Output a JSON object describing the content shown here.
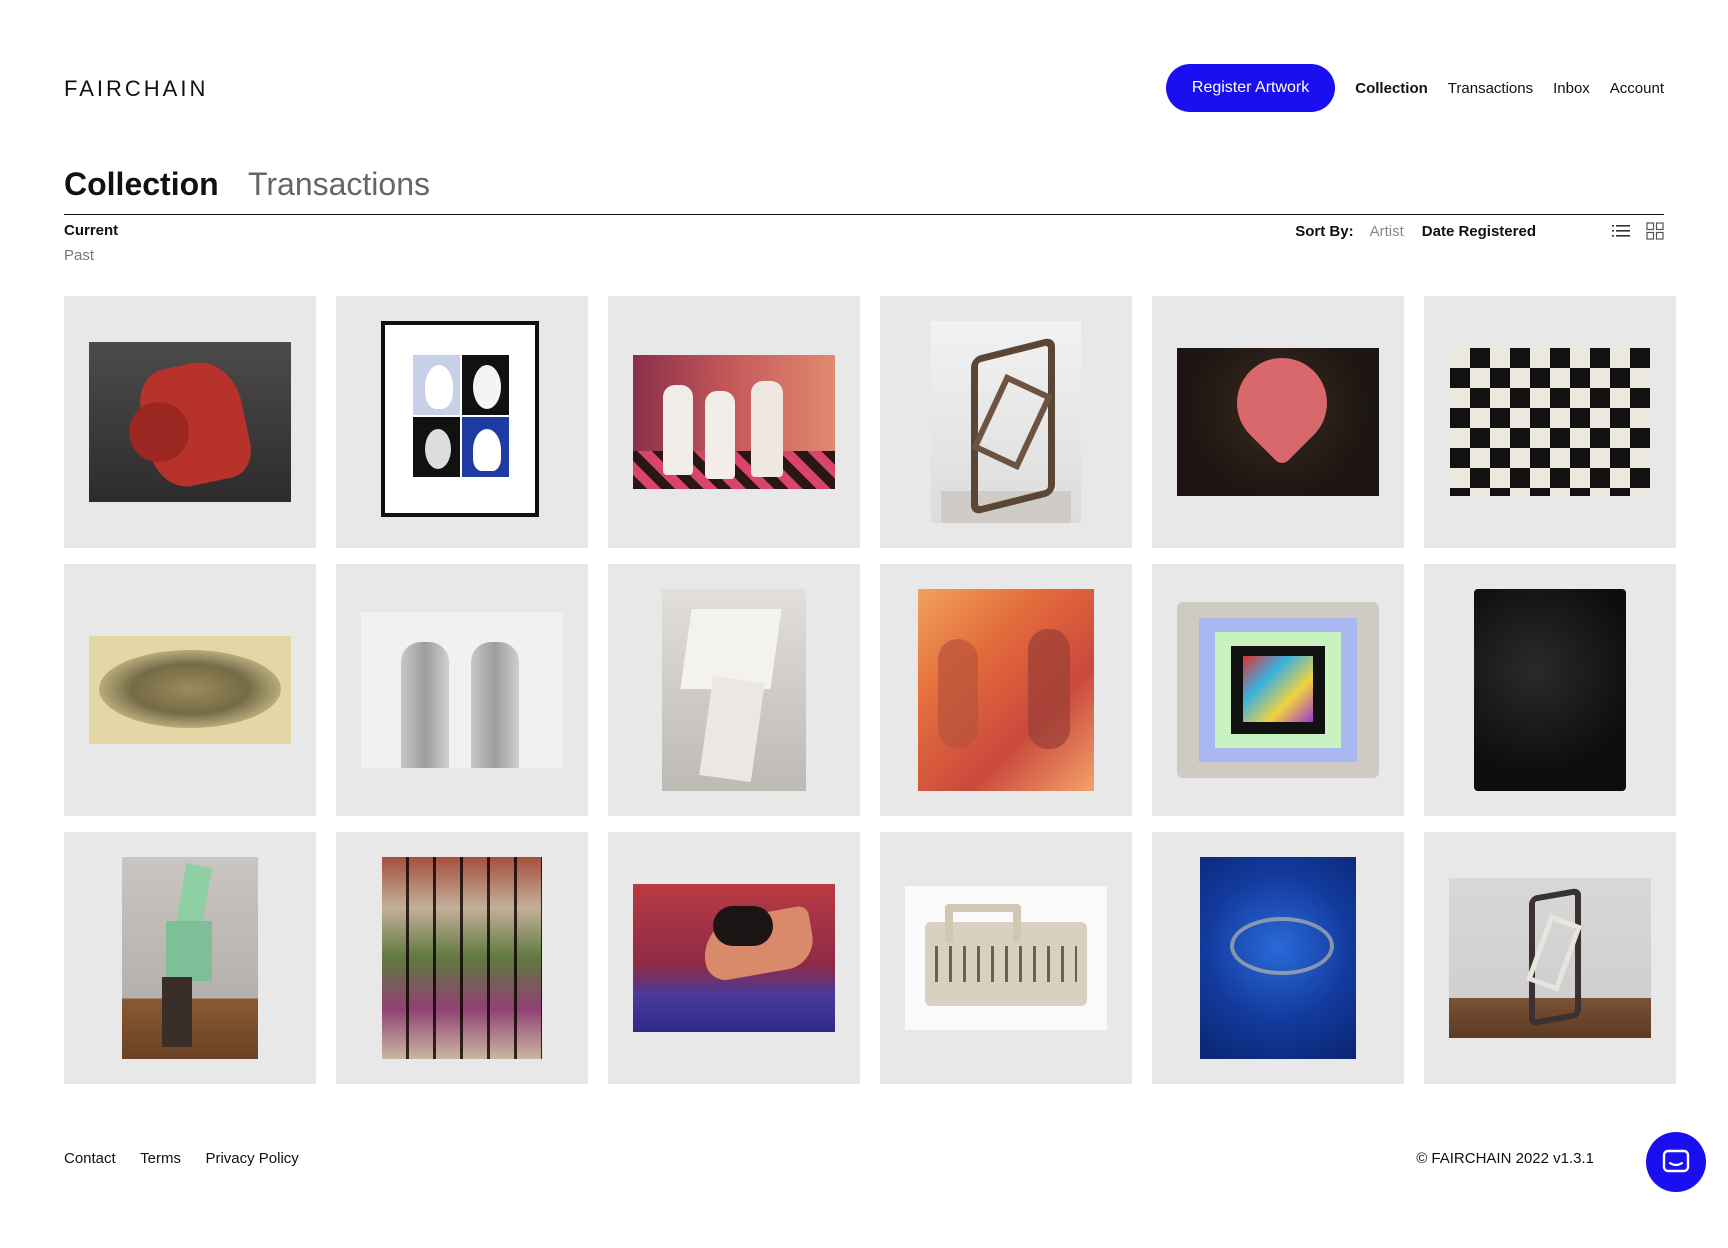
{
  "header": {
    "logo": "FAIRCHAIN",
    "register_label": "Register Artwork",
    "nav": [
      "Collection",
      "Transactions",
      "Inbox",
      "Account"
    ]
  },
  "tabs": {
    "collection": "Collection",
    "transactions": "Transactions"
  },
  "filters": {
    "current": "Current",
    "past": "Past"
  },
  "sort": {
    "label": "Sort By:",
    "options": [
      "Artist",
      "Date Registered"
    ],
    "selected": "Date Registered"
  },
  "icons": [
    "list-view-icon",
    "grid-view-icon",
    "chat-icon"
  ],
  "colors": {
    "accent": "#1a0ff0",
    "card_bg": "#e8e8e8"
  },
  "artworks": [
    {
      "name": "red-sculpture"
    },
    {
      "name": "framed-print-white-forms"
    },
    {
      "name": "figurines-nurses"
    },
    {
      "name": "bronze-abstract-sculpture"
    },
    {
      "name": "pink-heart-tongue"
    },
    {
      "name": "black-white-checker-painting"
    },
    {
      "name": "gold-engraving"
    },
    {
      "name": "silver-hands-sculpture"
    },
    {
      "name": "white-geometric-sculpture"
    },
    {
      "name": "orange-figures-painting"
    },
    {
      "name": "abstract-colorful-frame"
    },
    {
      "name": "black-textured-painting"
    },
    {
      "name": "green-wood-sculpture"
    },
    {
      "name": "color-swatch-tiles"
    },
    {
      "name": "reclining-woman-painting"
    },
    {
      "name": "carved-box-sculpture"
    },
    {
      "name": "blue-abstract-painting"
    },
    {
      "name": "metal-stacked-sculpture"
    }
  ],
  "footer": {
    "links": [
      "Contact",
      "Terms",
      "Privacy Policy"
    ],
    "copyright": "© FAIRCHAIN 2022 v1.3.1"
  }
}
